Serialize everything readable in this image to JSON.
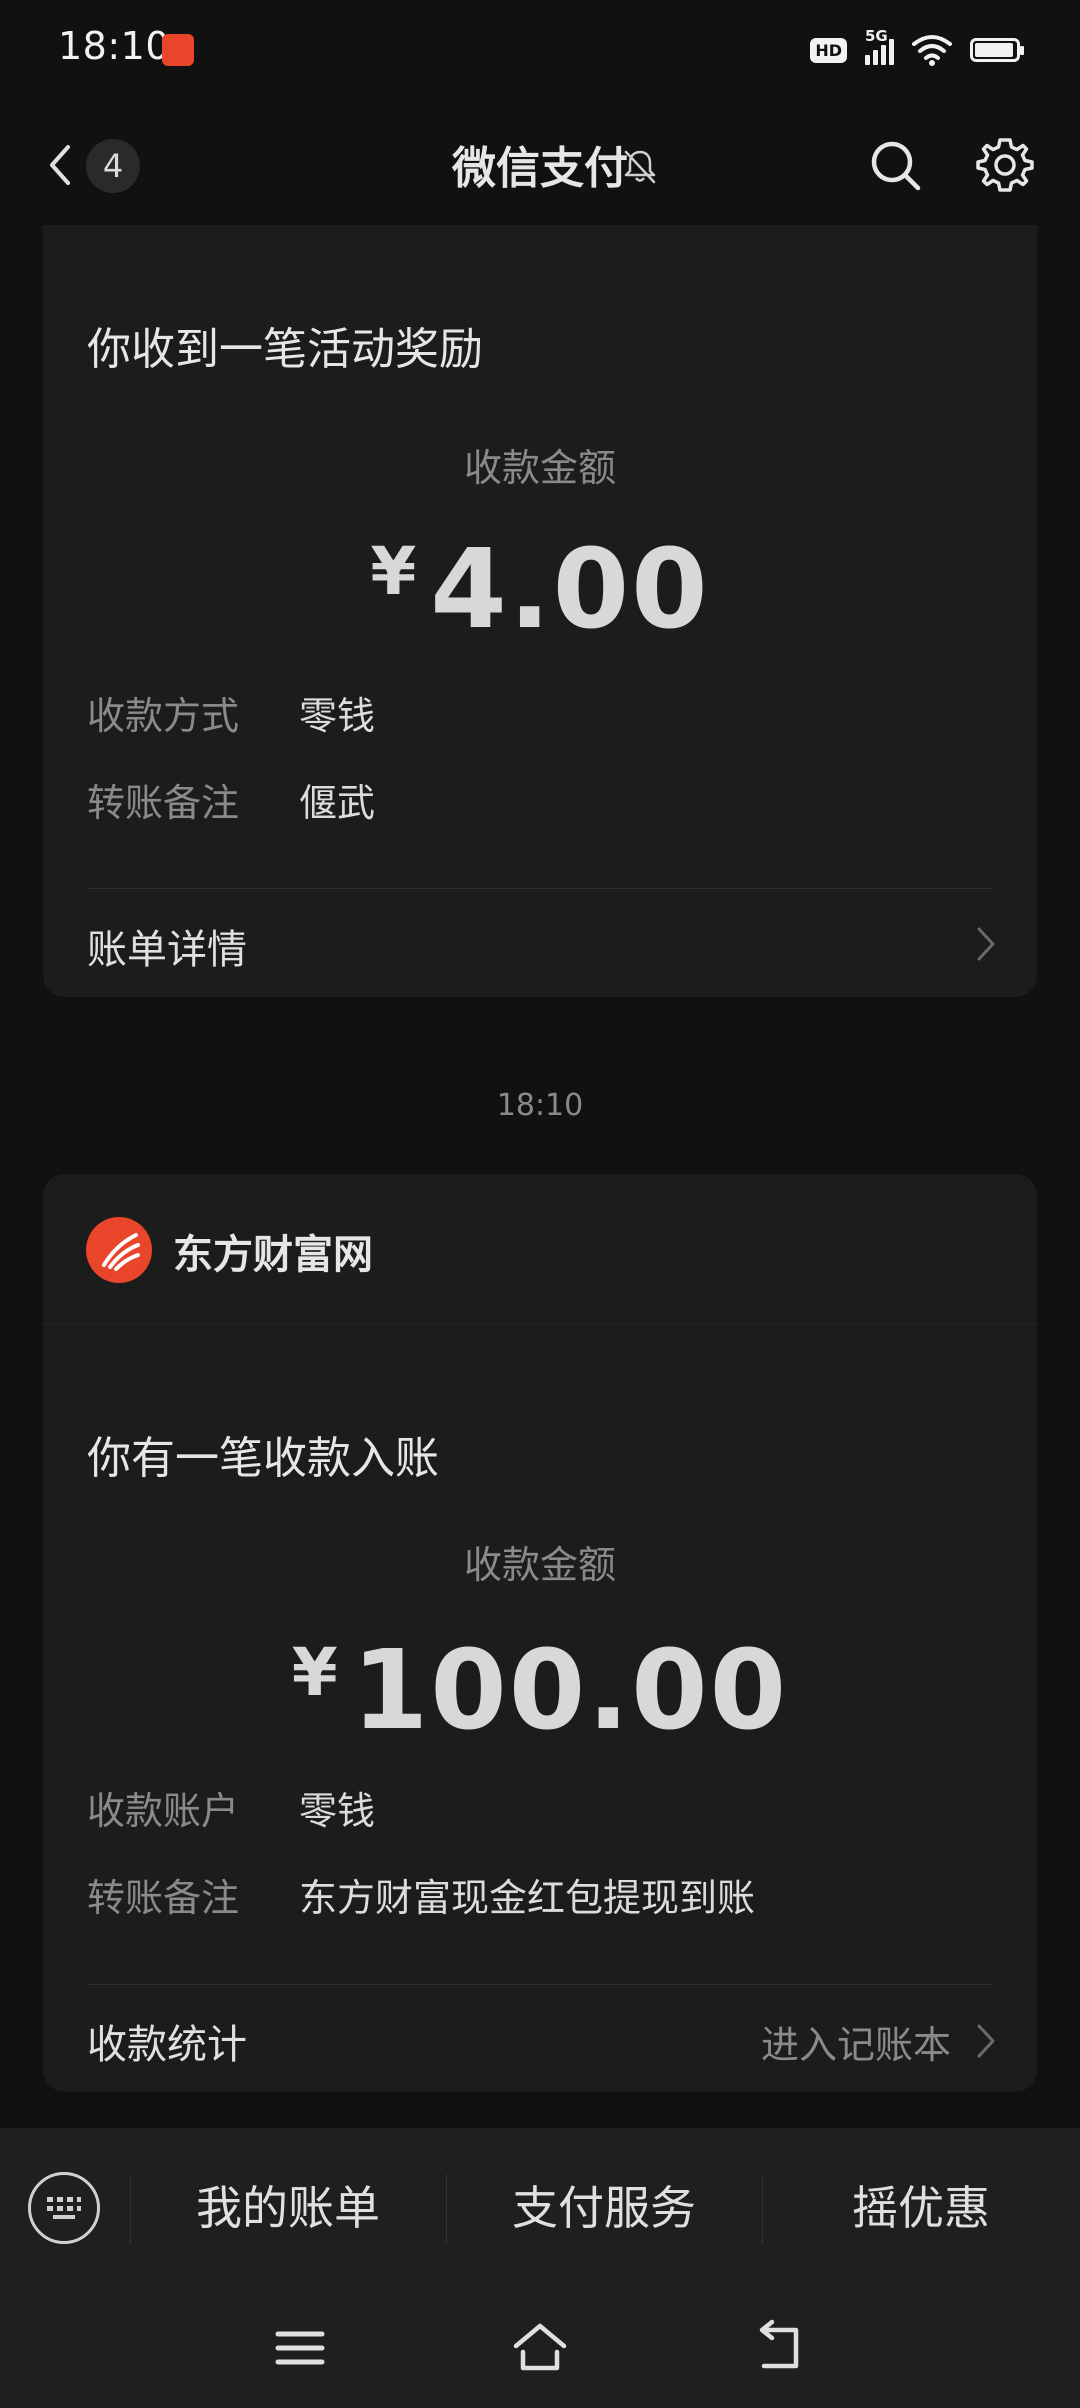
{
  "status_bar": {
    "time": "18:10",
    "network": "5G",
    "hd": "HD"
  },
  "header": {
    "back_count": "4",
    "title": "微信支付"
  },
  "cards": [
    {
      "title": "你收到一笔活动奖励",
      "amount_label": "收款金额",
      "currency": "¥",
      "amount": "4.00",
      "rows": [
        {
          "key": "收款方式",
          "value": "零钱"
        },
        {
          "key": "转账备注",
          "value": "偃武"
        }
      ],
      "footer_label": "账单详情"
    },
    {
      "brand": "东方财富网",
      "title": "你有一笔收款入账",
      "amount_label": "收款金额",
      "currency": "¥",
      "amount": "100.00",
      "rows": [
        {
          "key": "收款账户",
          "value": "零钱"
        },
        {
          "key": "转账备注",
          "value": "东方财富现金红包提现到账"
        }
      ],
      "footer_label": "收款统计",
      "footer_link": "进入记账本"
    }
  ],
  "timestamp": "18:10",
  "bottom_menu": {
    "items": [
      "我的账单",
      "支付服务",
      "摇优惠"
    ]
  },
  "colors": {
    "background": "#111111",
    "card": "#1c1c1c",
    "brand": "#e8452a"
  }
}
